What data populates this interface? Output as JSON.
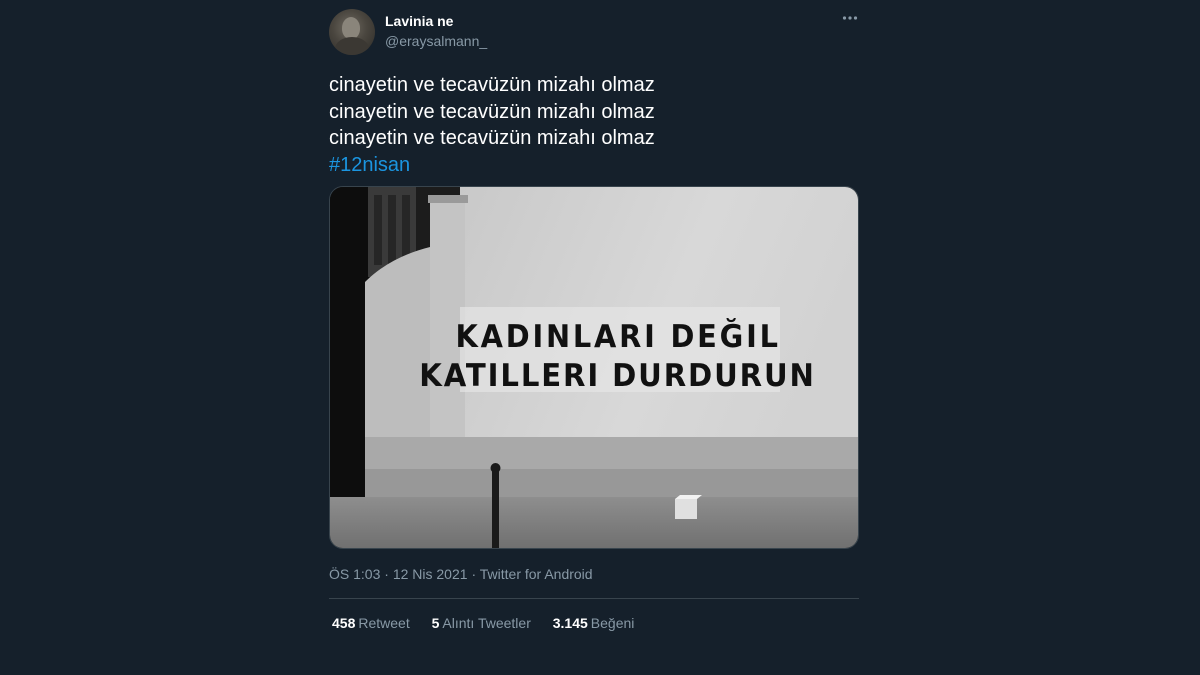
{
  "user": {
    "display_name": "Lavinia ne",
    "handle": "@eraysalmann_"
  },
  "more_icon": "more-horizontal-icon",
  "tweet": {
    "lines": [
      "cinayetin ve tecavüzün mizahı olmaz",
      "cinayetin ve tecavüzün mizahı olmaz",
      "cinayetin ve tecavüzün mizahı olmaz"
    ],
    "hashtag": "#12nisan"
  },
  "media": {
    "wall_text_line1": "KADINLARI DEĞIL",
    "wall_text_line2": "KATILLERI DURDURUN"
  },
  "meta": {
    "time": "ÖS 1:03",
    "date": "12 Nis 2021",
    "source": "Twitter for Android",
    "separator": "·"
  },
  "stats": {
    "retweets": {
      "count": "458",
      "label": "Retweet"
    },
    "quotes": {
      "count": "5",
      "label": "Alıntı Tweetler"
    },
    "likes": {
      "count": "3.145",
      "label": "Beğeni"
    }
  },
  "colors": {
    "background": "#15202b",
    "text": "#ffffff",
    "secondary": "#8899a6",
    "link": "#1b95e0",
    "border": "#38444d"
  }
}
